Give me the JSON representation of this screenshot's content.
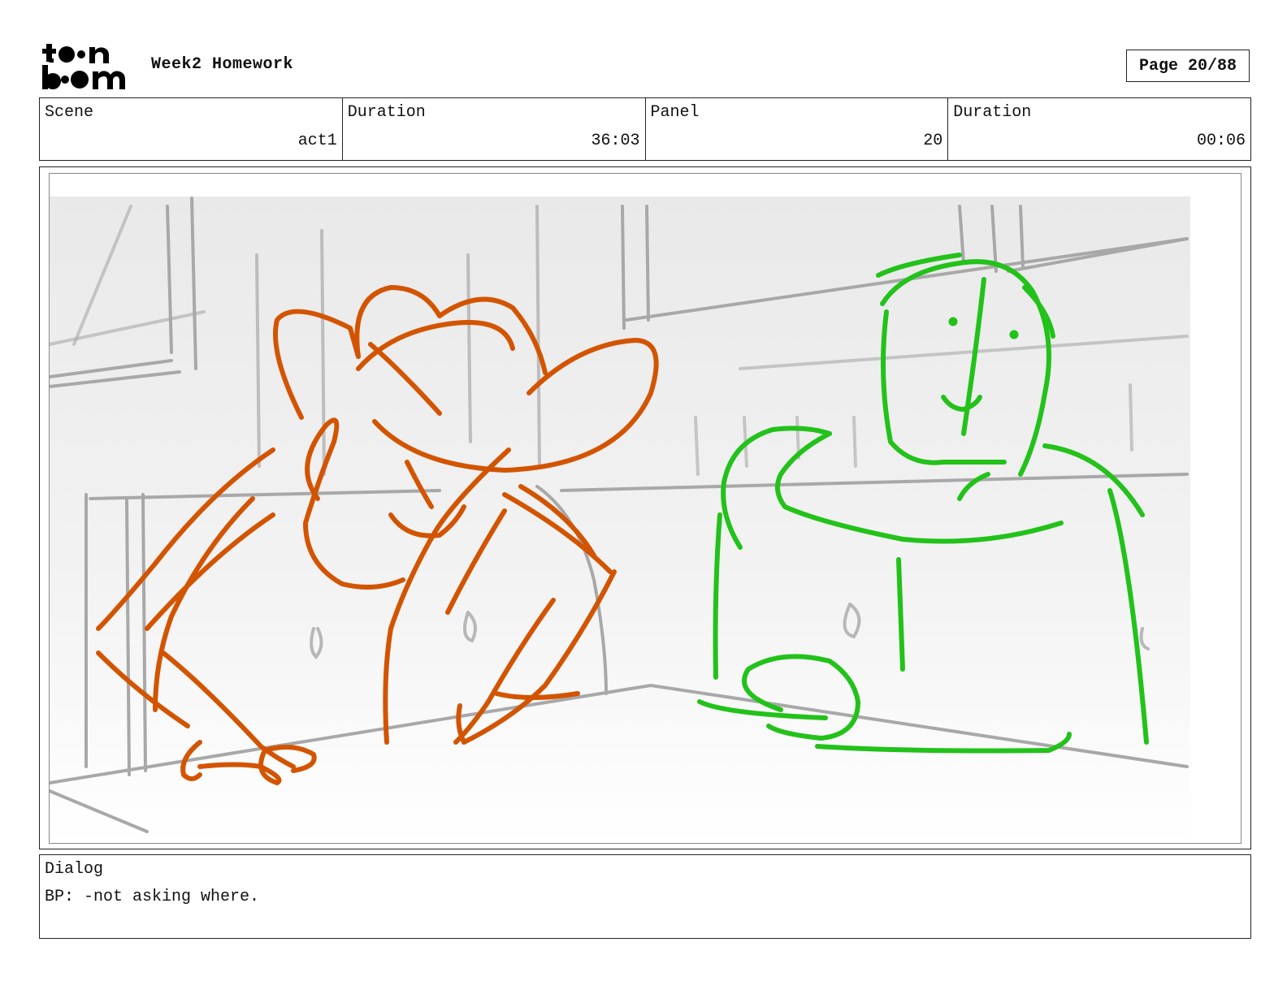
{
  "header": {
    "logo_text": "toon boom",
    "title": "Week2 Homework",
    "page": "Page 20/88"
  },
  "info": {
    "scene_label": "Scene",
    "scene_value": "act1",
    "duration_label": "Duration",
    "duration_value": "36:03",
    "panel_label": "Panel",
    "panel_value": "20",
    "panel_duration_label": "Duration",
    "panel_duration_value": "00:06"
  },
  "dialog": {
    "label": "Dialog",
    "text": "BP: -not asking where."
  },
  "colors": {
    "character_left": "#d35400",
    "character_right": "#22c21a",
    "background_sketch": "#a8a8a8"
  }
}
